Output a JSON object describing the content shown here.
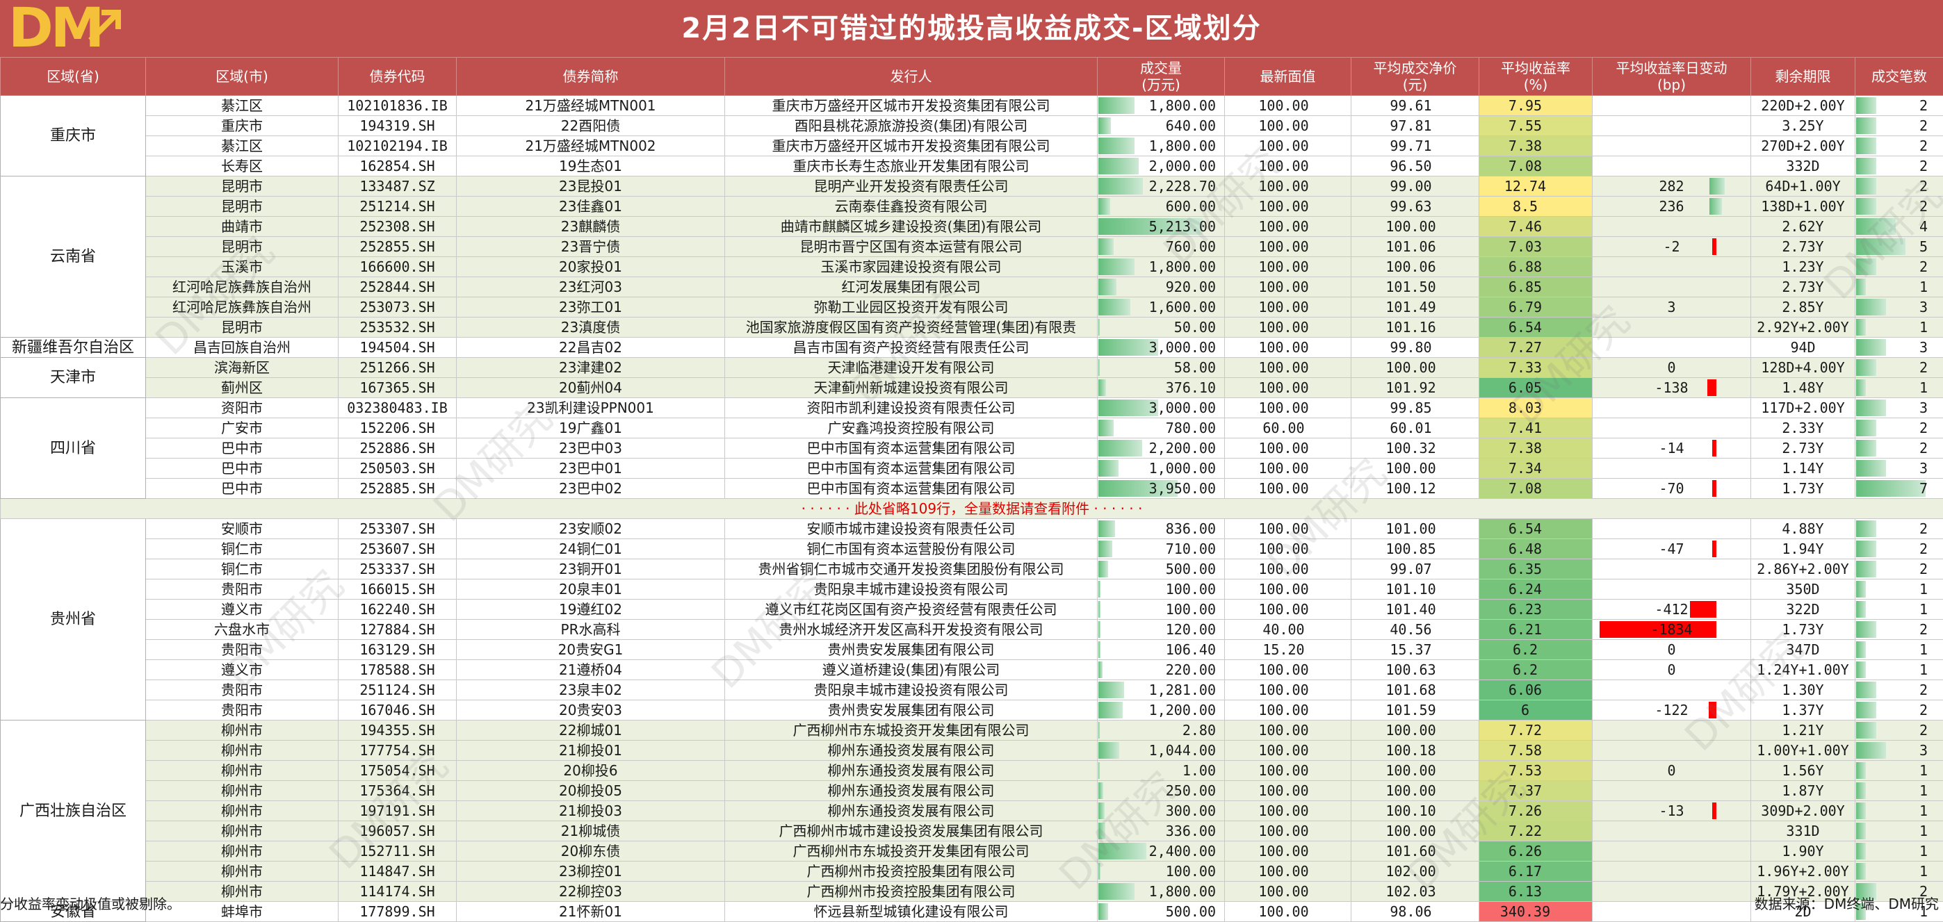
{
  "logo": "DM",
  "title": "2月2日不可错过的城投高收益成交-区域划分",
  "columns": [
    "区域(省)",
    "区域(市)",
    "债券代码",
    "债券简称",
    "发行人",
    "成交量\n(万元)",
    "最新面值",
    "平均成交净价\n(元)",
    "平均收益率\n(%)",
    "平均收益率日变动\n(bp)",
    "剩余期限",
    "成交笔数"
  ],
  "watermark": "DM研究",
  "groups": [
    {
      "province": "重庆市",
      "rows": [
        {
          "city": "綦江区",
          "code": "102101836.IB",
          "name": "21万盛经城MTN001",
          "issuer": "重庆市万盛经开区城市开发投资集团有限公司",
          "volume": "1,800.00",
          "vol_v": 1800,
          "face": "100.00",
          "price": "99.61",
          "yield": "7.95",
          "yield_v": 7.95,
          "chg": "",
          "chg_v": null,
          "term": "220D+2.00Y",
          "count": "2",
          "count_v": 2
        },
        {
          "city": "重庆市",
          "code": "194319.SH",
          "name": "22酉阳债",
          "issuer": "酉阳县桃花源旅游投资(集团)有限公司",
          "volume": "640.00",
          "vol_v": 640,
          "face": "100.00",
          "price": "97.81",
          "yield": "7.55",
          "yield_v": 7.55,
          "chg": "",
          "chg_v": null,
          "term": "3.25Y",
          "count": "2",
          "count_v": 2
        },
        {
          "city": "綦江区",
          "code": "102102194.IB",
          "name": "21万盛经城MTN002",
          "issuer": "重庆市万盛经开区城市开发投资集团有限公司",
          "volume": "1,800.00",
          "vol_v": 1800,
          "face": "100.00",
          "price": "99.71",
          "yield": "7.38",
          "yield_v": 7.38,
          "chg": "",
          "chg_v": null,
          "term": "270D+2.00Y",
          "count": "2",
          "count_v": 2
        },
        {
          "city": "长寿区",
          "code": "162854.SH",
          "name": "19生态01",
          "issuer": "重庆市长寿生态旅业开发集团有限公司",
          "volume": "2,000.00",
          "vol_v": 2000,
          "face": "100.00",
          "price": "96.50",
          "yield": "7.08",
          "yield_v": 7.08,
          "chg": "",
          "chg_v": null,
          "term": "332D",
          "count": "2",
          "count_v": 2
        }
      ]
    },
    {
      "province": "云南省",
      "rows": [
        {
          "city": "昆明市",
          "code": "133487.SZ",
          "name": "23昆投01",
          "issuer": "昆明产业开发投资有限责任公司",
          "volume": "2,228.70",
          "vol_v": 2228.7,
          "face": "100.00",
          "price": "99.00",
          "yield": "12.74",
          "yield_v": 12.74,
          "chg": "282",
          "chg_v": 282,
          "term": "64D+1.00Y",
          "count": "2",
          "count_v": 2
        },
        {
          "city": "昆明市",
          "code": "251214.SH",
          "name": "23佳鑫01",
          "issuer": "云南泰佳鑫投资有限公司",
          "volume": "600.00",
          "vol_v": 600,
          "face": "100.00",
          "price": "99.63",
          "yield": "8.5",
          "yield_v": 8.5,
          "chg": "236",
          "chg_v": 236,
          "term": "138D+1.00Y",
          "count": "2",
          "count_v": 2
        },
        {
          "city": "曲靖市",
          "code": "252308.SH",
          "name": "23麒麟债",
          "issuer": "曲靖市麒麟区城乡建设投资(集团)有限公司",
          "volume": "5,213.00",
          "vol_v": 5213,
          "face": "100.00",
          "price": "100.00",
          "yield": "7.46",
          "yield_v": 7.46,
          "chg": "",
          "chg_v": null,
          "term": "2.62Y",
          "count": "4",
          "count_v": 4
        },
        {
          "city": "昆明市",
          "code": "252855.SH",
          "name": "23晋宁债",
          "issuer": "昆明市晋宁区国有资本运营有限公司",
          "volume": "760.00",
          "vol_v": 760,
          "face": "100.00",
          "price": "101.06",
          "yield": "7.03",
          "yield_v": 7.03,
          "chg": "-2",
          "chg_v": -2,
          "term": "2.73Y",
          "count": "5",
          "count_v": 5
        },
        {
          "city": "玉溪市",
          "code": "166600.SH",
          "name": "20家投01",
          "issuer": "玉溪市家园建设投资有限公司",
          "volume": "1,800.00",
          "vol_v": 1800,
          "face": "100.00",
          "price": "100.06",
          "yield": "6.88",
          "yield_v": 6.88,
          "chg": "",
          "chg_v": null,
          "term": "1.23Y",
          "count": "2",
          "count_v": 2
        },
        {
          "city": "红河哈尼族彝族自治州",
          "code": "252844.SH",
          "name": "23红河03",
          "issuer": "红河发展集团有限公司",
          "volume": "920.00",
          "vol_v": 920,
          "face": "100.00",
          "price": "101.50",
          "yield": "6.85",
          "yield_v": 6.85,
          "chg": "",
          "chg_v": null,
          "term": "2.73Y",
          "count": "1",
          "count_v": 1
        },
        {
          "city": "红河哈尼族彝族自治州",
          "code": "253073.SH",
          "name": "23弥工01",
          "issuer": "弥勒工业园区投资开发有限公司",
          "volume": "1,600.00",
          "vol_v": 1600,
          "face": "100.00",
          "price": "101.49",
          "yield": "6.79",
          "yield_v": 6.79,
          "chg": "3",
          "chg_v": 3,
          "term": "2.85Y",
          "count": "3",
          "count_v": 3
        },
        {
          "city": "昆明市",
          "code": "253532.SH",
          "name": "23滇度债",
          "issuer": "池国家旅游度假区国有资产投资经营管理(集团)有限责",
          "volume": "50.00",
          "vol_v": 50,
          "face": "100.00",
          "price": "101.16",
          "yield": "6.54",
          "yield_v": 6.54,
          "chg": "",
          "chg_v": null,
          "term": "2.92Y+2.00Y",
          "count": "1",
          "count_v": 1
        }
      ]
    },
    {
      "province": "新疆维吾尔自治区",
      "rows": [
        {
          "city": "昌吉回族自治州",
          "code": "194504.SH",
          "name": "22昌吉02",
          "issuer": "昌吉市国有资产投资经营有限责任公司",
          "volume": "3,000.00",
          "vol_v": 3000,
          "face": "100.00",
          "price": "99.80",
          "yield": "7.27",
          "yield_v": 7.27,
          "chg": "",
          "chg_v": null,
          "term": "94D",
          "count": "3",
          "count_v": 3
        }
      ]
    },
    {
      "province": "天津市",
      "rows": [
        {
          "city": "滨海新区",
          "code": "251266.SH",
          "name": "23津建02",
          "issuer": "天津临港建设开发有限公司",
          "volume": "58.00",
          "vol_v": 58,
          "face": "100.00",
          "price": "100.00",
          "yield": "7.33",
          "yield_v": 7.33,
          "chg": "0",
          "chg_v": 0,
          "term": "128D+4.00Y",
          "count": "2",
          "count_v": 2
        },
        {
          "city": "蓟州区",
          "code": "167365.SH",
          "name": "20蓟州04",
          "issuer": "天津蓟州新城建设投资有限公司",
          "volume": "376.10",
          "vol_v": 376.1,
          "face": "100.00",
          "price": "101.92",
          "yield": "6.05",
          "yield_v": 6.05,
          "chg": "-138",
          "chg_v": -138,
          "term": "1.48Y",
          "count": "1",
          "count_v": 1
        }
      ]
    },
    {
      "province": "四川省",
      "rows": [
        {
          "city": "资阳市",
          "code": "032380483.IB",
          "name": "23凯利建设PPN001",
          "issuer": "资阳市凯利建设投资有限责任公司",
          "volume": "3,000.00",
          "vol_v": 3000,
          "face": "100.00",
          "price": "99.85",
          "yield": "8.03",
          "yield_v": 8.03,
          "chg": "",
          "chg_v": null,
          "term": "117D+2.00Y",
          "count": "3",
          "count_v": 3
        },
        {
          "city": "广安市",
          "code": "152206.SH",
          "name": "19广鑫01",
          "issuer": "广安鑫鸿投资控股有限公司",
          "volume": "780.00",
          "vol_v": 780,
          "face": "60.00",
          "price": "60.01",
          "yield": "7.41",
          "yield_v": 7.41,
          "chg": "",
          "chg_v": null,
          "term": "2.33Y",
          "count": "2",
          "count_v": 2
        },
        {
          "city": "巴中市",
          "code": "252886.SH",
          "name": "23巴中03",
          "issuer": "巴中市国有资本运营集团有限公司",
          "volume": "2,200.00",
          "vol_v": 2200,
          "face": "100.00",
          "price": "100.32",
          "yield": "7.38",
          "yield_v": 7.38,
          "chg": "-14",
          "chg_v": -14,
          "term": "2.73Y",
          "count": "2",
          "count_v": 2
        },
        {
          "city": "巴中市",
          "code": "250503.SH",
          "name": "23巴中01",
          "issuer": "巴中市国有资本运营集团有限公司",
          "volume": "1,000.00",
          "vol_v": 1000,
          "face": "100.00",
          "price": "100.00",
          "yield": "7.34",
          "yield_v": 7.34,
          "chg": "",
          "chg_v": null,
          "term": "1.14Y",
          "count": "3",
          "count_v": 3
        },
        {
          "city": "巴中市",
          "code": "252885.SH",
          "name": "23巴中02",
          "issuer": "巴中市国有资本运营集团有限公司",
          "volume": "3,950.00",
          "vol_v": 3950,
          "face": "100.00",
          "price": "100.12",
          "yield": "7.08",
          "yield_v": 7.08,
          "chg": "-70",
          "chg_v": -70,
          "term": "1.73Y",
          "count": "7",
          "count_v": 7
        }
      ]
    }
  ],
  "omitted_note": "· · · · · · 此处省略109行，全量数据请查看附件 · · · · · ·",
  "groups2": [
    {
      "province": "贵州省",
      "rows": [
        {
          "city": "安顺市",
          "code": "253307.SH",
          "name": "23安顺02",
          "issuer": "安顺市城市建设投资有限责任公司",
          "volume": "836.00",
          "vol_v": 836,
          "face": "100.00",
          "price": "101.00",
          "yield": "6.54",
          "yield_v": 6.54,
          "chg": "",
          "chg_v": null,
          "term": "4.88Y",
          "count": "2",
          "count_v": 2
        },
        {
          "city": "铜仁市",
          "code": "253607.SH",
          "name": "24铜仁01",
          "issuer": "铜仁市国有资本运营股份有限公司",
          "volume": "710.00",
          "vol_v": 710,
          "face": "100.00",
          "price": "100.85",
          "yield": "6.48",
          "yield_v": 6.48,
          "chg": "-47",
          "chg_v": -47,
          "term": "1.94Y",
          "count": "2",
          "count_v": 2
        },
        {
          "city": "铜仁市",
          "code": "253337.SH",
          "name": "23铜开01",
          "issuer": "贵州省铜仁市城市交通开发投资集团股份有限公司",
          "volume": "500.00",
          "vol_v": 500,
          "face": "100.00",
          "price": "99.07",
          "yield": "6.35",
          "yield_v": 6.35,
          "chg": "",
          "chg_v": null,
          "term": "2.86Y+2.00Y",
          "count": "2",
          "count_v": 2
        },
        {
          "city": "贵阳市",
          "code": "166015.SH",
          "name": "20泉丰01",
          "issuer": "贵阳泉丰城市建设投资有限公司",
          "volume": "100.00",
          "vol_v": 100,
          "face": "100.00",
          "price": "101.10",
          "yield": "6.24",
          "yield_v": 6.24,
          "chg": "",
          "chg_v": null,
          "term": "350D",
          "count": "1",
          "count_v": 1
        },
        {
          "city": "遵义市",
          "code": "162240.SH",
          "name": "19遵红02",
          "issuer": "遵义市红花岗区国有资产投资经营有限责任公司",
          "volume": "100.00",
          "vol_v": 100,
          "face": "100.00",
          "price": "101.40",
          "yield": "6.23",
          "yield_v": 6.23,
          "chg": "-412",
          "chg_v": -412,
          "term": "322D",
          "count": "1",
          "count_v": 1
        },
        {
          "city": "六盘水市",
          "code": "127884.SH",
          "name": "PR水高科",
          "issuer": "贵州水城经济开发区高科开发投资有限公司",
          "volume": "120.00",
          "vol_v": 120,
          "face": "40.00",
          "price": "40.56",
          "yield": "6.21",
          "yield_v": 6.21,
          "chg": "-1834",
          "chg_v": -1834,
          "term": "1.73Y",
          "count": "2",
          "count_v": 2
        },
        {
          "city": "贵阳市",
          "code": "163129.SH",
          "name": "20贵安G1",
          "issuer": "贵州贵安发展集团有限公司",
          "volume": "106.40",
          "vol_v": 106.4,
          "face": "15.20",
          "price": "15.37",
          "yield": "6.2",
          "yield_v": 6.2,
          "chg": "0",
          "chg_v": 0,
          "term": "347D",
          "count": "1",
          "count_v": 1
        },
        {
          "city": "遵义市",
          "code": "178588.SH",
          "name": "21遵桥04",
          "issuer": "遵义道桥建设(集团)有限公司",
          "volume": "220.00",
          "vol_v": 220,
          "face": "100.00",
          "price": "100.63",
          "yield": "6.2",
          "yield_v": 6.2,
          "chg": "0",
          "chg_v": 0,
          "term": "1.24Y+1.00Y",
          "count": "1",
          "count_v": 1
        },
        {
          "city": "贵阳市",
          "code": "251124.SH",
          "name": "23泉丰02",
          "issuer": "贵阳泉丰城市建设投资有限公司",
          "volume": "1,281.00",
          "vol_v": 1281,
          "face": "100.00",
          "price": "101.68",
          "yield": "6.06",
          "yield_v": 6.06,
          "chg": "",
          "chg_v": null,
          "term": "1.30Y",
          "count": "2",
          "count_v": 2
        },
        {
          "city": "贵阳市",
          "code": "167046.SH",
          "name": "20贵安03",
          "issuer": "贵州贵安发展集团有限公司",
          "volume": "1,200.00",
          "vol_v": 1200,
          "face": "100.00",
          "price": "101.59",
          "yield": "6",
          "yield_v": 6,
          "chg": "-122",
          "chg_v": -122,
          "term": "1.37Y",
          "count": "2",
          "count_v": 2
        }
      ]
    },
    {
      "province": "广西壮族自治区",
      "rows": [
        {
          "city": "柳州市",
          "code": "194355.SH",
          "name": "22柳城01",
          "issuer": "广西柳州市东城投资开发集团有限公司",
          "volume": "2.80",
          "vol_v": 2.8,
          "face": "100.00",
          "price": "100.00",
          "yield": "7.72",
          "yield_v": 7.72,
          "chg": "",
          "chg_v": null,
          "term": "1.21Y",
          "count": "2",
          "count_v": 2
        },
        {
          "city": "柳州市",
          "code": "177754.SH",
          "name": "21柳投01",
          "issuer": "柳州东通投资发展有限公司",
          "volume": "1,044.00",
          "vol_v": 1044,
          "face": "100.00",
          "price": "100.18",
          "yield": "7.58",
          "yield_v": 7.58,
          "chg": "",
          "chg_v": null,
          "term": "1.00Y+1.00Y",
          "count": "3",
          "count_v": 3
        },
        {
          "city": "柳州市",
          "code": "175054.SH",
          "name": "20柳投6",
          "issuer": "柳州东通投资发展有限公司",
          "volume": "1.00",
          "vol_v": 1,
          "face": "100.00",
          "price": "100.00",
          "yield": "7.53",
          "yield_v": 7.53,
          "chg": "0",
          "chg_v": 0,
          "term": "1.56Y",
          "count": "1",
          "count_v": 1
        },
        {
          "city": "柳州市",
          "code": "175364.SH",
          "name": "20柳投05",
          "issuer": "柳州东通投资发展有限公司",
          "volume": "250.00",
          "vol_v": 250,
          "face": "100.00",
          "price": "100.00",
          "yield": "7.37",
          "yield_v": 7.37,
          "chg": "",
          "chg_v": null,
          "term": "1.87Y",
          "count": "1",
          "count_v": 1
        },
        {
          "city": "柳州市",
          "code": "197191.SH",
          "name": "21柳投03",
          "issuer": "柳州东通投资发展有限公司",
          "volume": "300.00",
          "vol_v": 300,
          "face": "100.00",
          "price": "100.10",
          "yield": "7.26",
          "yield_v": 7.26,
          "chg": "-13",
          "chg_v": -13,
          "term": "309D+2.00Y",
          "count": "1",
          "count_v": 1
        },
        {
          "city": "柳州市",
          "code": "196057.SH",
          "name": "21柳城债",
          "issuer": "广西柳州市城市建设投资发展集团有限公司",
          "volume": "336.00",
          "vol_v": 336,
          "face": "100.00",
          "price": "100.00",
          "yield": "7.22",
          "yield_v": 7.22,
          "chg": "",
          "chg_v": null,
          "term": "331D",
          "count": "1",
          "count_v": 1
        },
        {
          "city": "柳州市",
          "code": "152711.SH",
          "name": "20柳东债",
          "issuer": "广西柳州市东城投资开发集团有限公司",
          "volume": "2,400.00",
          "vol_v": 2400,
          "face": "100.00",
          "price": "101.60",
          "yield": "6.26",
          "yield_v": 6.26,
          "chg": "",
          "chg_v": null,
          "term": "1.90Y",
          "count": "1",
          "count_v": 1
        },
        {
          "city": "柳州市",
          "code": "114847.SH",
          "name": "23柳控01",
          "issuer": "广西柳州市投资控股集团有限公司",
          "volume": "100.00",
          "vol_v": 100,
          "face": "100.00",
          "price": "102.00",
          "yield": "6.17",
          "yield_v": 6.17,
          "chg": "",
          "chg_v": null,
          "term": "1.96Y+2.00Y",
          "count": "1",
          "count_v": 1
        },
        {
          "city": "柳州市",
          "code": "114174.SH",
          "name": "22柳控03",
          "issuer": "广西柳州市投资控股集团有限公司",
          "volume": "1,800.00",
          "vol_v": 1800,
          "face": "100.00",
          "price": "102.03",
          "yield": "6.13",
          "yield_v": 6.13,
          "chg": "",
          "chg_v": null,
          "term": "1.79Y+2.00Y",
          "count": "2",
          "count_v": 2
        }
      ]
    },
    {
      "province": "安徽省",
      "rows": [
        {
          "city": "蚌埠市",
          "code": "177899.SH",
          "name": "21怀新01",
          "issuer": "怀远县新型城镇化建设有限公司",
          "volume": "500.00",
          "vol_v": 500,
          "face": "100.00",
          "price": "98.06",
          "yield": "340.39",
          "yield_v": 340.39,
          "chg": "",
          "chg_v": null,
          "term": "2D",
          "count": "1",
          "count_v": 1
        }
      ]
    }
  ],
  "footer_note": "分收益率变动极值或被剔除。",
  "footer_source": "数据来源：DM终端、DM研究",
  "colors": {
    "header": "#c0504d",
    "band": "#ebf1de",
    "bar_green": "#63be7b",
    "neg_red": "#ff0000"
  }
}
